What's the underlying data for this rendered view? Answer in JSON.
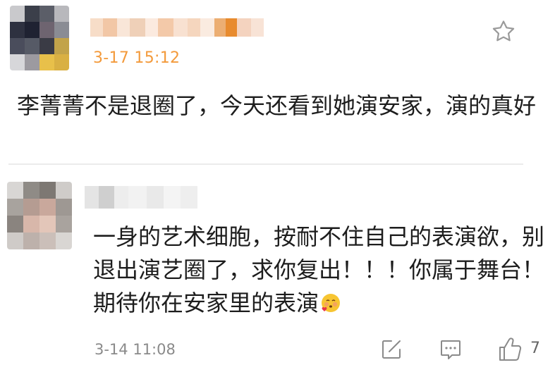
{
  "comments": [
    {
      "time": "3-17 15:12",
      "text": "李菁菁不是退圈了，今天还看到她演安家，演的真好",
      "star_icon": "star-outline-icon",
      "accent_color": "#f39a3b"
    },
    {
      "time": "3-14 11:08",
      "text": "一身的艺术细胞，按耐不住自己的表演欲，别退出演艺圈了，求你复出！！！你属于舞台！期待你在安家里的表演",
      "emoji_icon": "blushing-face-with-hearts-emoji",
      "actions": {
        "edit_icon": "edit-share-icon",
        "comment_icon": "comment-bubble-icon",
        "like_icon": "thumbs-up-icon",
        "like_count": "7"
      }
    }
  ]
}
